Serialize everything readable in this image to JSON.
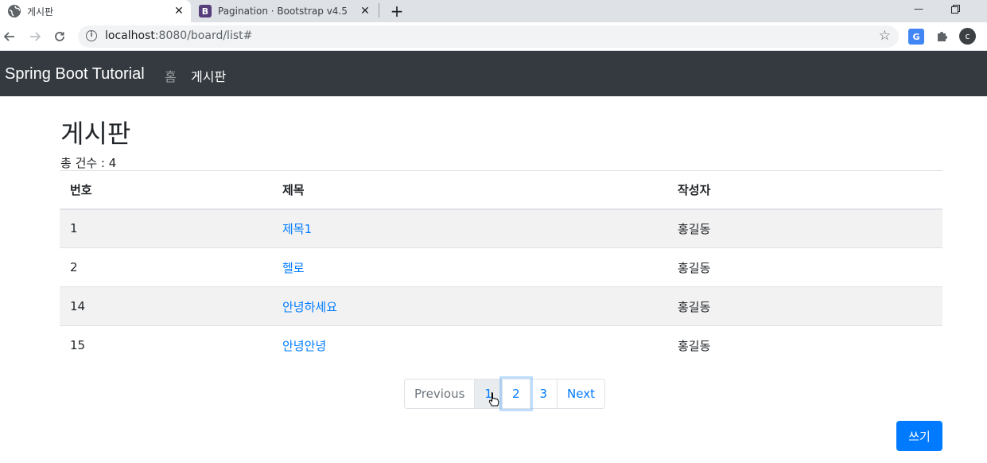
{
  "browser": {
    "tabs": [
      {
        "title": "게시판",
        "icon": "globe-icon",
        "active": true
      },
      {
        "title": "Pagination · Bootstrap v4.5",
        "icon": "bootstrap-icon",
        "active": false
      }
    ],
    "bootstrap_glyph": "B",
    "address": {
      "host": "localhost",
      "path": ":8080/board/list#"
    },
    "profile_initial": "c"
  },
  "navbar": {
    "brand": "Spring Boot Tutorial",
    "links": [
      "홈",
      "게시판"
    ],
    "background": "#343a40"
  },
  "main": {
    "title": "게시판",
    "total_label": "총 건수 : 4",
    "table": {
      "headers": [
        "번호",
        "제목",
        "작성자"
      ],
      "rows": [
        {
          "no": "1",
          "title": "제목1",
          "author": "홍길동"
        },
        {
          "no": "2",
          "title": "헬로",
          "author": "홍길동"
        },
        {
          "no": "14",
          "title": "안녕하세요",
          "author": "홍길동"
        },
        {
          "no": "15",
          "title": "안녕안녕",
          "author": "홍길동"
        }
      ]
    },
    "pagination": {
      "previous": "Previous",
      "pages": [
        "1",
        "2",
        "3"
      ],
      "next": "Next",
      "current": "1"
    },
    "write_button": "쓰기",
    "accent_color": "#007bff"
  }
}
